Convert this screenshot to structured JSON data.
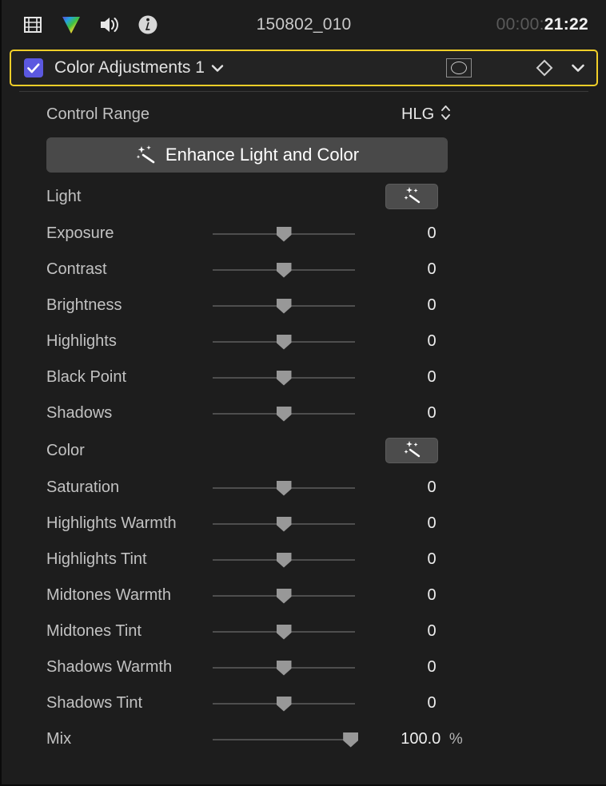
{
  "window": {
    "background_color": "#1d1d1d",
    "accent_color": "#f2cf28",
    "checkbox_color": "#5b58e0"
  },
  "toolbar": {
    "icons": [
      {
        "name": "video-icon",
        "label": "Video"
      },
      {
        "name": "color-icon",
        "label": "Color"
      },
      {
        "name": "audio-icon",
        "label": "Audio"
      },
      {
        "name": "info-icon",
        "label": "Info"
      }
    ],
    "clip_title": "150802_010",
    "timecode_dim": "00:00:",
    "timecode_bright": "21:22"
  },
  "effect_header": {
    "enabled": true,
    "title": "Color Adjustments 1",
    "disclosure_icon": "chevron-down-icon",
    "mask_icon": "shape-mask-icon",
    "keyframe_icon": "keyframe-diamond-icon",
    "menu_icon": "chevron-down-icon"
  },
  "control_range": {
    "label": "Control Range",
    "value": "HLG",
    "stepper_icon": "up-down-stepper-icon"
  },
  "enhance": {
    "label": "Enhance Light and Color",
    "icon": "magic-wand-icon"
  },
  "sections": [
    {
      "label": "Light",
      "button_icon": "magic-wand-icon",
      "sliders": [
        {
          "label": "Exposure",
          "value": "0",
          "unit": "",
          "pos": 50
        },
        {
          "label": "Contrast",
          "value": "0",
          "unit": "",
          "pos": 50
        },
        {
          "label": "Brightness",
          "value": "0",
          "unit": "",
          "pos": 50
        },
        {
          "label": "Highlights",
          "value": "0",
          "unit": "",
          "pos": 50
        },
        {
          "label": "Black Point",
          "value": "0",
          "unit": "",
          "pos": 50
        },
        {
          "label": "Shadows",
          "value": "0",
          "unit": "",
          "pos": 50
        }
      ]
    },
    {
      "label": "Color",
      "button_icon": "magic-wand-icon",
      "sliders": [
        {
          "label": "Saturation",
          "value": "0",
          "unit": "",
          "pos": 50
        },
        {
          "label": "Highlights Warmth",
          "value": "0",
          "unit": "",
          "pos": 50
        },
        {
          "label": "Highlights Tint",
          "value": "0",
          "unit": "",
          "pos": 50
        },
        {
          "label": "Midtones Warmth",
          "value": "0",
          "unit": "",
          "pos": 50
        },
        {
          "label": "Midtones Tint",
          "value": "0",
          "unit": "",
          "pos": 50
        },
        {
          "label": "Shadows Warmth",
          "value": "0",
          "unit": "",
          "pos": 50
        },
        {
          "label": "Shadows Tint",
          "value": "0",
          "unit": "",
          "pos": 50
        }
      ]
    }
  ],
  "mix": {
    "label": "Mix",
    "value": "100.0",
    "unit": "%",
    "pos": 97
  }
}
